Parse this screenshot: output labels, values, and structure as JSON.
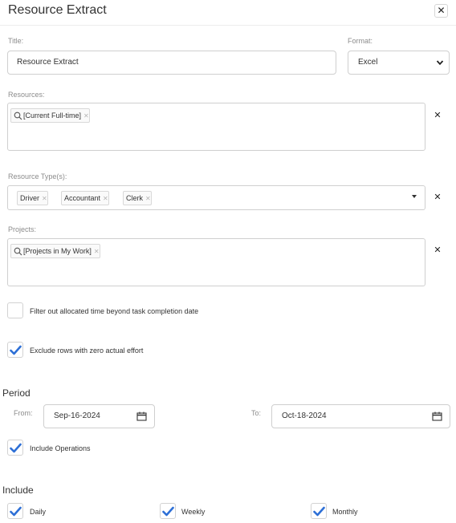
{
  "dialog": {
    "title": "Resource Extract"
  },
  "fields": {
    "title_label": "Title:",
    "title_value": "Resource Extract",
    "format_label": "Format:",
    "format_value": "Excel",
    "resources_label": "Resources:",
    "resources": [
      "[Current Full-time]"
    ],
    "resource_types_label": "Resource Type(s):",
    "resource_types": [
      "Driver",
      "Accountant",
      "Clerk"
    ],
    "projects_label": "Projects:",
    "projects": [
      "[Projects in My Work]"
    ]
  },
  "options": {
    "filter_allocated": {
      "label": "Filter out allocated time beyond task completion date",
      "checked": false
    },
    "exclude_zero": {
      "label": "Exclude rows with zero actual effort",
      "checked": true
    }
  },
  "period": {
    "heading": "Period",
    "from_label": "From:",
    "from_value": "Sep-16-2024",
    "to_label": "To:",
    "to_value": "Oct-18-2024",
    "include_operations": {
      "label": "Include Operations",
      "checked": true
    }
  },
  "include": {
    "heading": "Include",
    "daily": {
      "label": "Daily",
      "checked": true
    },
    "weekly": {
      "label": "Weekly",
      "checked": true
    },
    "monthly": {
      "label": "Monthly",
      "checked": true
    }
  },
  "colors": {
    "checkmark": "#2d6fd6",
    "border": "#cfcfcf",
    "label": "#8c8c8c"
  },
  "icons": {
    "close": "close-icon",
    "search": "search-icon",
    "calendar": "calendar-icon",
    "check": "check-icon"
  }
}
